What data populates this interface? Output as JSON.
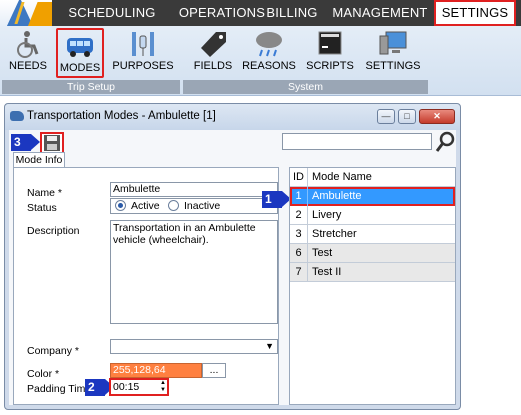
{
  "nav": {
    "tabs": [
      {
        "label": "SCHEDULING"
      },
      {
        "label": "OPERATIONS"
      },
      {
        "label": "BILLING"
      },
      {
        "label": "MANAGEMENT"
      },
      {
        "label": "SETTINGS",
        "active": true
      }
    ]
  },
  "ribbon": {
    "groups": [
      {
        "label": "Trip Setup",
        "buttons": [
          {
            "label": "NEEDS",
            "icon": "wheelchair-icon"
          },
          {
            "label": "MODES",
            "icon": "bus-icon",
            "highlighted": true
          },
          {
            "label": "PURPOSES",
            "icon": "iv-drip-icon"
          }
        ]
      },
      {
        "label": "System",
        "buttons": [
          {
            "label": "FIELDS",
            "icon": "tag-icon"
          },
          {
            "label": "REASONS",
            "icon": "storm-cloud-icon"
          },
          {
            "label": "SCRIPTS",
            "icon": "console-icon"
          },
          {
            "label": "SETTINGS",
            "icon": "monitor-icon"
          }
        ]
      }
    ]
  },
  "window": {
    "title": "Transportation Modes - Ambulette [1]",
    "tab": "Mode Info",
    "callouts": {
      "save": "3",
      "grid_row": "1",
      "padding": "2"
    },
    "form": {
      "name_label": "Name *",
      "name_value": "Ambulette",
      "status_label": "Status",
      "status_active": "Active",
      "status_inactive": "Inactive",
      "description_label": "Description",
      "description_value": "Transportation in an Ambulette vehicle (wheelchair).",
      "company_label": "Company *",
      "company_value": "",
      "color_label": "Color *",
      "color_value": "255,128,64",
      "color_browse": "...",
      "padding_label": "Padding Tim",
      "padding_value": "00:15"
    },
    "grid": {
      "headers": {
        "id": "ID",
        "name": "Mode Name"
      },
      "rows": [
        {
          "id": "1",
          "name": "Ambulette",
          "selected": true
        },
        {
          "id": "2",
          "name": "Livery"
        },
        {
          "id": "3",
          "name": "Stretcher"
        },
        {
          "id": "6",
          "name": "Test"
        },
        {
          "id": "7",
          "name": "Test II"
        }
      ]
    }
  },
  "colors": {
    "highlight": "#e02020",
    "callout": "#1b37c0",
    "selection": "#3399ff",
    "swatch": "#ff8040"
  }
}
